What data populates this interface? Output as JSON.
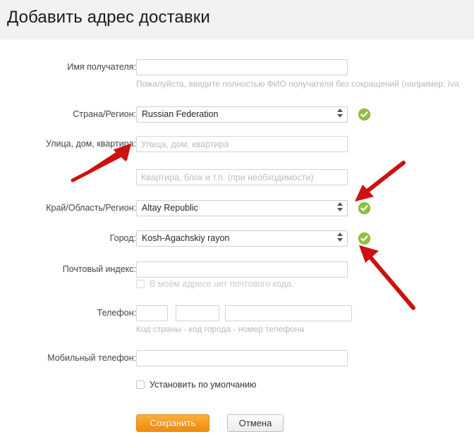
{
  "header": {
    "title": "Добавить адрес доставки"
  },
  "form": {
    "recipient_name": {
      "label": "Имя получателя:",
      "value": "",
      "placeholder": "",
      "hint": "Пожалуйста, введите полностью ФИО получателя без сокращений (например: Iva"
    },
    "country": {
      "label": "Страна/Регион:",
      "value": "Russian Federation",
      "options": [
        "Russian Federation"
      ],
      "valid": true
    },
    "street": {
      "label": "Улица, дом, квартира:",
      "value": "",
      "placeholder": "Улица, дом, квартира"
    },
    "street2": {
      "label": "",
      "value": "",
      "placeholder": "Квартира, блок и т.п. (при необходимости)"
    },
    "region": {
      "label": "Край/Область/Регион:",
      "value": "Altay Republic",
      "options": [
        "Altay Republic"
      ],
      "valid": true
    },
    "city": {
      "label": "Город:",
      "value": "Kosh-Agachskiy rayon",
      "options": [
        "Kosh-Agachskiy rayon"
      ],
      "valid": true
    },
    "postal_code": {
      "label": "Почтовый индекс:",
      "value": "",
      "placeholder": ""
    },
    "no_postal_code": {
      "label": "В моём адресе нет почтового кода.",
      "checked": false,
      "disabled": true
    },
    "phone": {
      "label": "Телефон:",
      "country_code": "",
      "area_code": "",
      "number": "",
      "hint": "Код страны - код города - номер телефона"
    },
    "mobile_phone": {
      "label": "Мобильный телефон:",
      "value": "",
      "placeholder": ""
    },
    "set_default": {
      "label": "Установить по умолчанию",
      "checked": false
    }
  },
  "actions": {
    "save": "Сохранить",
    "cancel": "Отмена"
  },
  "colors": {
    "accent_orange": "#f79a22",
    "valid_green": "#94bf44",
    "annotation_red": "#cc1111",
    "header_band": "#f2f2f2"
  },
  "annotations": [
    {
      "name": "arrow-to-street-field",
      "direction": "up-right"
    },
    {
      "name": "arrow-to-region-check",
      "direction": "down-left"
    },
    {
      "name": "arrow-to-city-check",
      "direction": "up-left"
    }
  ]
}
